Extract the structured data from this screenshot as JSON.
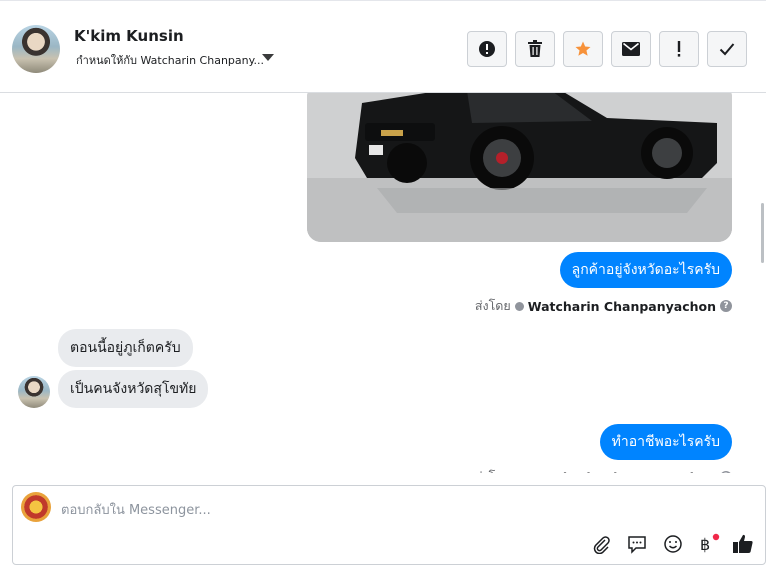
{
  "header": {
    "contact_name": "K'kim Kunsin",
    "assigned_to": "กำหนดให้กับ Watcharin Chanpany..."
  },
  "toolbar": {
    "buttons": [
      {
        "name": "report-spam-button",
        "icon": "alert-circle-icon"
      },
      {
        "name": "delete-button",
        "icon": "trash-icon"
      },
      {
        "name": "star-button",
        "icon": "star-icon"
      },
      {
        "name": "mark-unread-button",
        "icon": "envelope-icon"
      },
      {
        "name": "follow-up-button",
        "icon": "exclamation-icon"
      },
      {
        "name": "mark-done-button",
        "icon": "check-icon"
      }
    ],
    "star_color": "#f7923a"
  },
  "conversation": {
    "messages": [
      {
        "direction": "out",
        "type": "image",
        "alt": ""
      },
      {
        "direction": "out",
        "type": "text",
        "text": "ลูกค้าอยู่จังหวัดอะไรครับ"
      },
      {
        "direction": "in",
        "type": "text",
        "text": "ตอนนี้อยู่ภูเก็ตครับ"
      },
      {
        "direction": "in",
        "type": "text",
        "text": "เป็นคนจังหวัดสุโขทัย"
      },
      {
        "direction": "out",
        "type": "text",
        "text": "ทำอาชีพอะไรครับ"
      }
    ],
    "sent_by_prefix": "ส่งโดย",
    "sent_by_name": "Watcharin Chanpanyachon",
    "bubble_color": "#0084ff",
    "incoming_bubble_color": "#e9ebee"
  },
  "composer": {
    "placeholder": "ตอบกลับใน Messenger...",
    "icons": [
      "paperclip-icon",
      "saved-reply-icon",
      "emoji-icon",
      "payment-icon",
      "like-icon"
    ]
  }
}
